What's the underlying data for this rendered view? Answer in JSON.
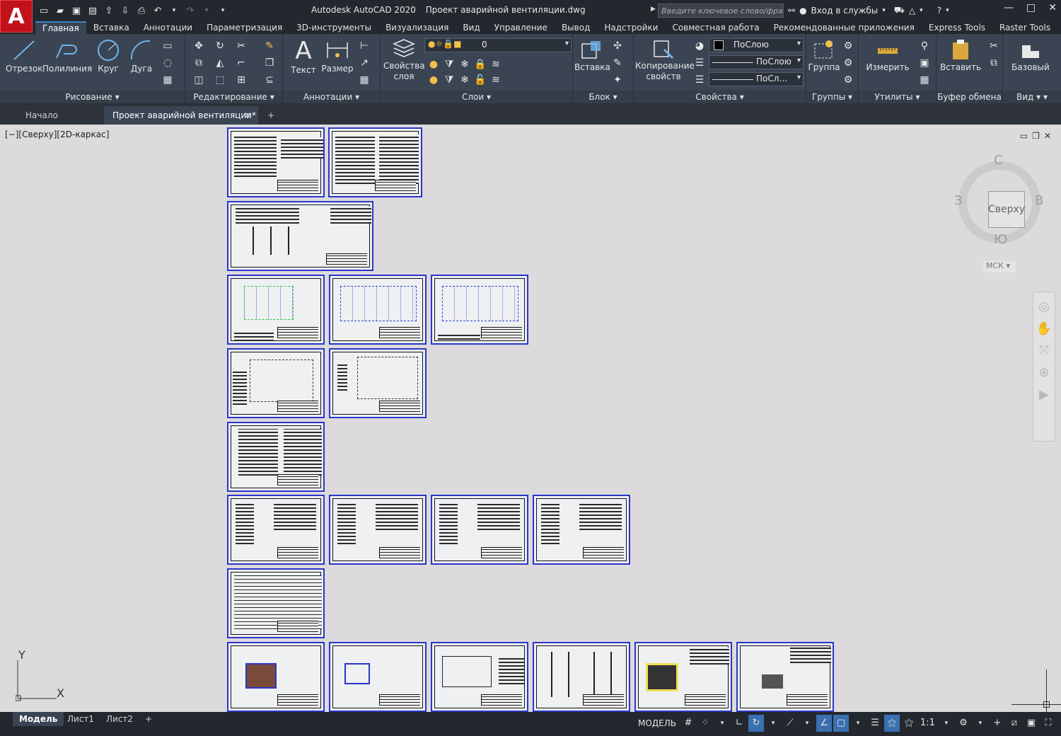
{
  "app": {
    "logo": "A",
    "title": "Autodesk AutoCAD 2020",
    "file": "Проект аварийной вентиляции.dwg"
  },
  "search": {
    "placeholder": "Введите ключевое слово/фразу"
  },
  "account": {
    "signin": "Вход в службы"
  },
  "ribbon_tabs": [
    "Главная",
    "Вставка",
    "Аннотации",
    "Параметризация",
    "3D-инструменты",
    "Визуализация",
    "Вид",
    "Управление",
    "Вывод",
    "Надстройки",
    "Совместная работа",
    "Рекомендованные приложения",
    "Express Tools",
    "Raster Tools"
  ],
  "ribbon": {
    "draw": {
      "title": "Рисование",
      "line": "Отрезок",
      "polyline": "Полилиния",
      "circle": "Круг",
      "arc": "Дуга"
    },
    "modify": {
      "title": "Редактирование"
    },
    "annotation": {
      "title": "Аннотации",
      "text": "Текст",
      "dimension": "Размер"
    },
    "layers": {
      "title": "Слои",
      "layer_props": "Свойства слоя",
      "layer_props_1": "Свойства",
      "layer_props_2": "слоя",
      "current_layer": "0"
    },
    "block": {
      "title": "Блок",
      "insert": "Вставка"
    },
    "properties": {
      "title": "Свойства",
      "match": "Копирование свойств",
      "match_1": "Копирование",
      "match_2": "свойств",
      "color": "ПоСлою",
      "linetype": "ПоСлою",
      "lineweight": "ПоСл..."
    },
    "groups": {
      "title": "Группы",
      "group": "Группа"
    },
    "utilities": {
      "title": "Утилиты",
      "measure": "Измерить"
    },
    "clipboard": {
      "title": "Буфер обмена",
      "paste": "Вставить"
    },
    "view": {
      "title": "Вид",
      "base": "Базовый"
    }
  },
  "doc_tabs": {
    "start": "Начало",
    "active": "Проект аварийной вентиляции*",
    "add": "+"
  },
  "viewport": {
    "label": "[−][Сверху][2D-каркас]"
  },
  "viewcube": {
    "face": "Сверху",
    "north": "С",
    "south": "Ю",
    "west": "З",
    "east": "В",
    "ucs": "МСК"
  },
  "ucs_icon": {
    "x": "X",
    "y": "Y"
  },
  "layout_tabs": [
    "Модель",
    "Лист1",
    "Лист2"
  ],
  "status": {
    "model": "МОДЕЛЬ",
    "scale": "1:1"
  }
}
